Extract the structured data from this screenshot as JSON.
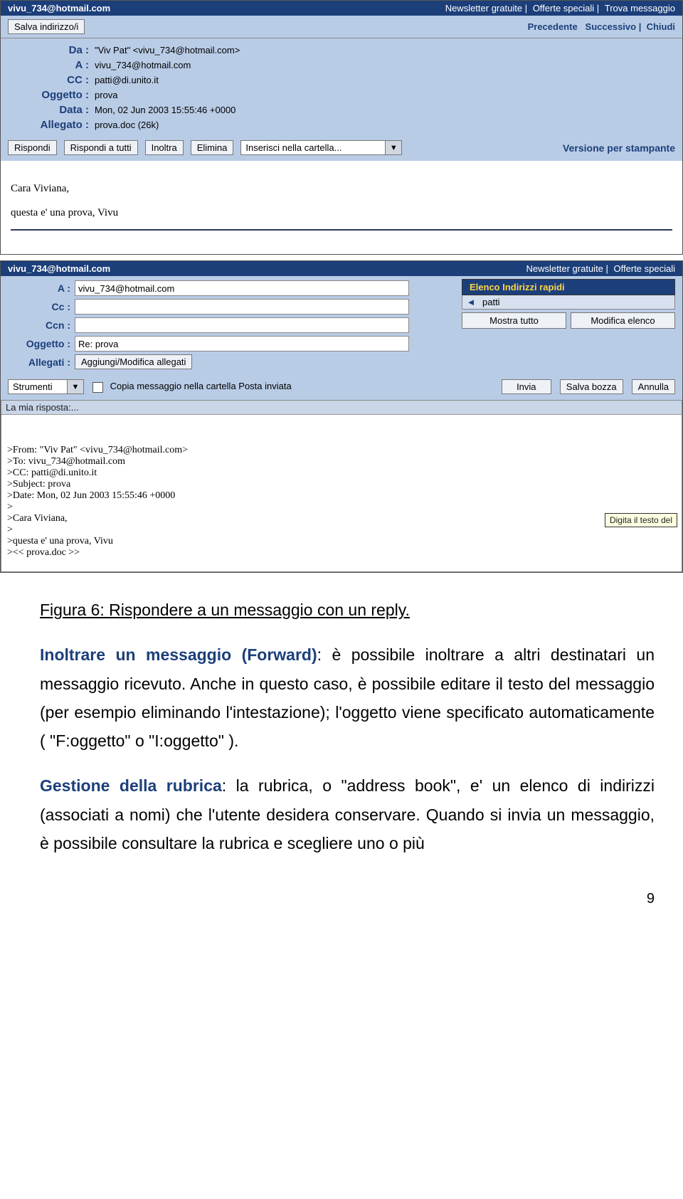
{
  "read": {
    "account": "vivu_734@hotmail.com",
    "topLinks": {
      "a": "Newsletter gratuite",
      "b": "Offerte speciali",
      "c": "Trova messaggio"
    },
    "saveAddr": "Salva indirizzo/i",
    "nav": {
      "prev": "Precedente",
      "next": "Successivo",
      "close": "Chiudi"
    },
    "labels": {
      "from": "Da :",
      "to": "A :",
      "cc": "CC :",
      "subject": "Oggetto :",
      "date": "Data :",
      "attach": "Allegato :"
    },
    "values": {
      "from": "\"Viv Pat\" <vivu_734@hotmail.com>",
      "to": "vivu_734@hotmail.com",
      "cc": "patti@di.unito.it",
      "subject": "prova",
      "date": "Mon, 02 Jun 2003 15:55:46 +0000",
      "attach": "prova.doc (26k)"
    },
    "actions": {
      "reply": "Rispondi",
      "replyAll": "Rispondi a tutti",
      "forward": "Inoltra",
      "delete": "Elimina"
    },
    "folderDropdown": "Inserisci nella cartella...",
    "printVersion": "Versione per stampante",
    "body": "Cara Viviana,\n\nquesta e' una prova, Vivu"
  },
  "compose": {
    "account": "vivu_734@hotmail.com",
    "topLinks": {
      "a": "Newsletter gratuite",
      "b": "Offerte speciali"
    },
    "labels": {
      "to": "A :",
      "cc": "Cc :",
      "bcc": "Ccn :",
      "subject": "Oggetto :",
      "attach": "Allegati :"
    },
    "values": {
      "to": "vivu_734@hotmail.com",
      "subject": "Re: prova"
    },
    "attachBtn": "Aggiungi/Modifica allegati",
    "side": {
      "header": "Elenco Indirizzi rapidi",
      "name": "patti",
      "showAll": "Mostra tutto",
      "editList": "Modifica elenco"
    },
    "tools": {
      "label": "Strumenti",
      "copyCheckbox": "Copia messaggio nella cartella Posta inviata",
      "send": "Invia",
      "draft": "Salva bozza",
      "cancel": "Annulla"
    },
    "replyHeader": "La mia risposta:...",
    "replyBody": "\n\n>From: \"Viv Pat\" <vivu_734@hotmail.com>\n>To: vivu_734@hotmail.com\n>CC: patti@di.unito.it\n>Subject: prova\n>Date: Mon, 02 Jun 2003 15:55:46 +0000\n>\n>Cara Viviana,\n>\n>questa e' una prova, Vivu\n><< prova.doc >>",
    "tooltip": "Digita il testo del"
  },
  "doc": {
    "caption": "Figura 6: Rispondere a un messaggio con un reply.",
    "p1a": "Inoltrare un messaggio (Forward)",
    "p1b": ": è possibile inoltrare a altri destinatari un messaggio ricevuto. Anche in questo caso, è possibile editare il testo del messaggio (per esempio eliminando l'intestazione); l'oggetto viene specificato automaticamente ( \"F:oggetto\" o \"I:oggetto\" ).",
    "p2a": "Gestione della rubrica",
    "p2b": ": la rubrica, o \"address book\", e' un elenco di indirizzi (associati a nomi) che l'utente desidera conservare. Quando si invia un messaggio, è possibile consultare la rubrica e scegliere uno o più",
    "pageNum": "9"
  }
}
